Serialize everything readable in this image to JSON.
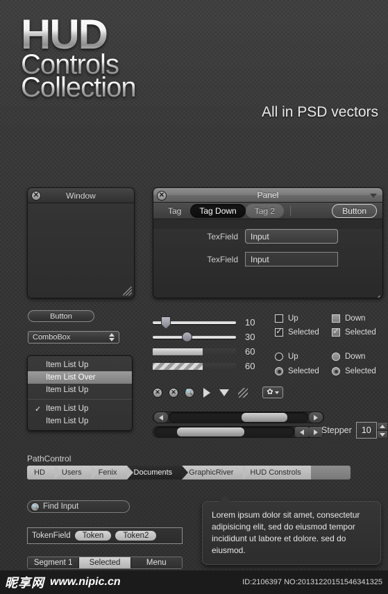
{
  "hero": {
    "line1": "HUD",
    "line2": "Controls",
    "line3": "Collection",
    "tagline": "All in PSD vectors"
  },
  "window": {
    "title": "Window",
    "close_icon": "close-icon",
    "grip_icon": "resize-grip-icon"
  },
  "panel": {
    "title": "Panel",
    "close_icon": "close-icon",
    "caret_icon": "chevron-down-icon",
    "tabs": [
      {
        "label": "Tag",
        "state": "normal"
      },
      {
        "label": "Tag Down",
        "state": "down"
      },
      {
        "label": "Tag 2",
        "state": "alt"
      }
    ],
    "button_label": "Button",
    "fields": [
      {
        "label": "TexField",
        "value": "Input",
        "shape": "rounded"
      },
      {
        "label": "TexField",
        "value": "Input",
        "shape": "square"
      }
    ]
  },
  "controls": {
    "button_label": "Button",
    "combobox_value": "ComboBox"
  },
  "item_list": {
    "group1": [
      {
        "label": "Item List Up",
        "state": "up"
      },
      {
        "label": "Item List Over",
        "state": "over"
      },
      {
        "label": "Item List Up",
        "state": "up"
      }
    ],
    "group2": [
      {
        "label": "Item List Up",
        "checked": true,
        "check_glyph": "✓"
      },
      {
        "label": "Item List Up",
        "checked": false,
        "check_glyph": ""
      }
    ]
  },
  "sliders": [
    {
      "type": "slider-pointer",
      "value": "10"
    },
    {
      "type": "slider-round",
      "value": "30"
    },
    {
      "type": "progress-solid",
      "value": "60"
    },
    {
      "type": "progress-striped",
      "value": "60"
    }
  ],
  "checkboxes": [
    {
      "label": "Up",
      "state": "up",
      "checked": false
    },
    {
      "label": "Down",
      "state": "down",
      "checked": false
    },
    {
      "label": "Selected",
      "state": "up",
      "checked": true
    },
    {
      "label": "Selected",
      "state": "down",
      "checked": true
    }
  ],
  "radios": [
    {
      "label": "Up",
      "state": "up",
      "selected": false
    },
    {
      "label": "Down",
      "state": "down",
      "selected": false
    },
    {
      "label": "Selected",
      "state": "up",
      "selected": true
    },
    {
      "label": "Selected",
      "state": "down",
      "selected": true
    }
  ],
  "icons": [
    "close-circle-icon",
    "close-circle-icon",
    "search-circle-icon",
    "play-triangle-icon",
    "chevron-down-triangle-icon",
    "resize-grip-icon",
    "gear-dropdown-button"
  ],
  "gear_glyph": "✿",
  "scrollbars": [
    {
      "name": "scrollbar-both-ends",
      "thumb_left_pct": 52,
      "thumb_width_pct": 33
    },
    {
      "name": "scrollbar-arrows-right",
      "thumb_left_pct": 16,
      "thumb_width_pct": 48
    }
  ],
  "stepper": {
    "label": "Stepper",
    "value": "10"
  },
  "pathcontrol": {
    "label": "PathControl",
    "crumbs": [
      {
        "label": "HD",
        "selected": false
      },
      {
        "label": "Users",
        "selected": false
      },
      {
        "label": "Fenix",
        "selected": false
      },
      {
        "label": "Documents",
        "selected": true
      },
      {
        "label": "GraphicRiver",
        "selected": false
      },
      {
        "label": "HUD Constrols",
        "selected": false
      }
    ]
  },
  "find": {
    "value": "Find Input",
    "icon": "search-icon"
  },
  "tokenfield": {
    "label": "TokenField",
    "tokens": [
      "Token",
      "Token2"
    ]
  },
  "segmented": [
    {
      "label": "Segment 1",
      "selected": false
    },
    {
      "label": "Selected",
      "selected": true
    },
    {
      "label": "Menu",
      "selected": false
    }
  ],
  "tooltip": {
    "text": "Lorem ipsum dolor sit amet, consectetur adipisicing elit, sed do eiusmod tempor incididunt ut labore et dolore. sed do eiusmod."
  },
  "footer": {
    "logo": "昵享网",
    "url": "www.nipic.cn",
    "id": "ID:2106397 NO:20131220151546341325"
  }
}
